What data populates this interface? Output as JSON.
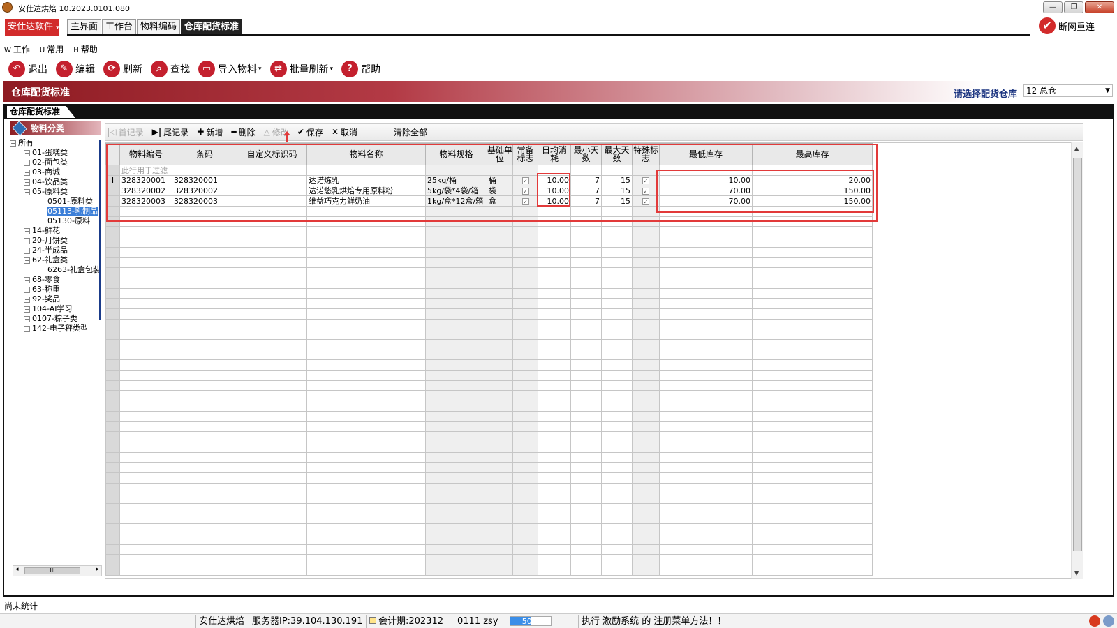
{
  "window": {
    "title": "安仕达烘焙   10.2023.0101.080",
    "buttons": [
      "—",
      "❐",
      "✕"
    ]
  },
  "brand": {
    "label": "安仕达软件",
    "caret": "▾"
  },
  "top_tabs": [
    {
      "label": "主界面",
      "active": false
    },
    {
      "label": "工作台",
      "active": false
    },
    {
      "label": "物料编码",
      "active": false
    },
    {
      "label": "仓库配货标准",
      "active": true
    }
  ],
  "reconnect": {
    "label": "断网重连",
    "icon": "✔"
  },
  "sub_menu": [
    {
      "key": "W",
      "label": "工作"
    },
    {
      "key": "U",
      "label": "常用"
    },
    {
      "key": "H",
      "label": "帮助"
    }
  ],
  "toolbar": [
    {
      "label": "退出",
      "icon": "exit-icon",
      "glyph": "↶",
      "caret": ""
    },
    {
      "label": "编辑",
      "icon": "edit-icon",
      "glyph": "✎",
      "caret": ""
    },
    {
      "label": "刷新",
      "icon": "refresh-icon",
      "glyph": "⟳",
      "caret": ""
    },
    {
      "label": "查找",
      "icon": "search-icon",
      "glyph": "⌕",
      "caret": ""
    },
    {
      "label": "导入物料",
      "icon": "folder-icon",
      "glyph": "▭",
      "caret": "▾"
    },
    {
      "label": "批量刷新",
      "icon": "batch-refresh-icon",
      "glyph": "⇄",
      "caret": "▾"
    },
    {
      "label": "帮助",
      "icon": "help-icon",
      "glyph": "?",
      "caret": ""
    }
  ],
  "banner": {
    "title": "仓库配货标准",
    "warehouse_label": "请选择配货仓库",
    "warehouse_value": "12 总仓",
    "caret": "▼"
  },
  "inner_tab": {
    "label": "仓库配货标准"
  },
  "tree": {
    "header": "物料分类",
    "items": [
      {
        "label": "所有",
        "level": 0,
        "pm": "−",
        "selected": false
      },
      {
        "label": "01-蛋糕类",
        "level": 1,
        "pm": "+",
        "selected": false
      },
      {
        "label": "02-面包类",
        "level": 1,
        "pm": "+",
        "selected": false
      },
      {
        "label": "03-商城",
        "level": 1,
        "pm": "+",
        "selected": false
      },
      {
        "label": "04-饮品类",
        "level": 1,
        "pm": "+",
        "selected": false
      },
      {
        "label": "05-原料类",
        "level": 1,
        "pm": "−",
        "selected": false
      },
      {
        "label": "0501-原料类",
        "level": 2,
        "pm": "",
        "selected": false
      },
      {
        "label": "05113-乳制品",
        "level": 2,
        "pm": "",
        "selected": true
      },
      {
        "label": "05130-原料",
        "level": 2,
        "pm": "",
        "selected": false
      },
      {
        "label": "14-鲜花",
        "level": 1,
        "pm": "+",
        "selected": false
      },
      {
        "label": "20-月饼类",
        "level": 1,
        "pm": "+",
        "selected": false
      },
      {
        "label": "24-半成品",
        "level": 1,
        "pm": "+",
        "selected": false
      },
      {
        "label": "62-礼盒类",
        "level": 1,
        "pm": "−",
        "selected": false
      },
      {
        "label": "6263-礼盒包装",
        "level": 2,
        "pm": "",
        "selected": false
      },
      {
        "label": "68-零食",
        "level": 1,
        "pm": "+",
        "selected": false
      },
      {
        "label": "63-称重",
        "level": 1,
        "pm": "+",
        "selected": false
      },
      {
        "label": "92-奖品",
        "level": 1,
        "pm": "+",
        "selected": false
      },
      {
        "label": "104-AI学习",
        "level": 1,
        "pm": "+",
        "selected": false
      },
      {
        "label": "0107-粽子类",
        "level": 1,
        "pm": "+",
        "selected": false
      },
      {
        "label": "142-电子秤类型",
        "level": 1,
        "pm": "+",
        "selected": false
      }
    ],
    "hscroll_thumb": "III",
    "hscroll_left": "◂",
    "hscroll_right": "▸"
  },
  "grid_toolbar": [
    {
      "label": "首记录",
      "icon": "first-record-icon",
      "glyph": "|◁",
      "enabled": false
    },
    {
      "label": "尾记录",
      "icon": "last-record-icon",
      "glyph": "▶|",
      "enabled": true
    },
    {
      "label": "新增",
      "icon": "add-icon",
      "glyph": "✚",
      "enabled": true
    },
    {
      "label": "删除",
      "icon": "delete-icon",
      "glyph": "━",
      "enabled": true
    },
    {
      "label": "修改",
      "icon": "modify-icon",
      "glyph": "△",
      "enabled": false
    },
    {
      "label": "保存",
      "icon": "save-check-icon",
      "glyph": "✔",
      "enabled": true
    },
    {
      "label": "取消",
      "icon": "cancel-icon",
      "glyph": "✕",
      "enabled": true
    },
    {
      "label": "清除全部",
      "icon": "",
      "glyph": "",
      "enabled": true
    }
  ],
  "grid": {
    "columns": [
      "物料编号",
      "条码",
      "自定义标识码",
      "物料名称",
      "物料规格",
      "基础单位",
      "常备标志",
      "日均消耗",
      "最小天数",
      "最大天数",
      "特殊标志",
      "最低库存",
      "最高库存"
    ],
    "filter_placeholder": "此行用于过滤",
    "current_marker": "I",
    "rows": [
      {
        "code": "328320001",
        "barcode": "328320001",
        "custom": "",
        "name": "达诺炼乳",
        "spec": "25kg/桶",
        "unit": "桶",
        "standby": true,
        "daily": "10.00",
        "min_days": "7",
        "max_days": "15",
        "special": true,
        "min_stock": "10.00",
        "max_stock": "20.00"
      },
      {
        "code": "328320002",
        "barcode": "328320002",
        "custom": "",
        "name": "达诺悠乳烘焙专用原料粉",
        "spec": "5kg/袋*4袋/箱",
        "unit": "袋",
        "standby": true,
        "daily": "10.00",
        "min_days": "7",
        "max_days": "15",
        "special": true,
        "min_stock": "70.00",
        "max_stock": "150.00"
      },
      {
        "code": "328320003",
        "barcode": "328320003",
        "custom": "",
        "name": "维益巧克力鲜奶油",
        "spec": "1kg/盒*12盒/箱",
        "unit": "盒",
        "standby": true,
        "daily": "10.00",
        "min_days": "7",
        "max_days": "15",
        "special": true,
        "min_stock": "70.00",
        "max_stock": "150.00"
      }
    ]
  },
  "status_line": "尚未统计",
  "statusbar": {
    "company": "安仕达烘焙",
    "server": "服务器IP:39.104.130.191",
    "period": "会计期:202312",
    "user": "0111 zsy",
    "progress": 0.5,
    "progress_label": "50%",
    "message": "执行 激励系统 的 注册菜单方法！！"
  },
  "colors": {
    "accent": "#c4202e",
    "highlight": "#e23a3a",
    "selection": "#3c7fd8"
  }
}
